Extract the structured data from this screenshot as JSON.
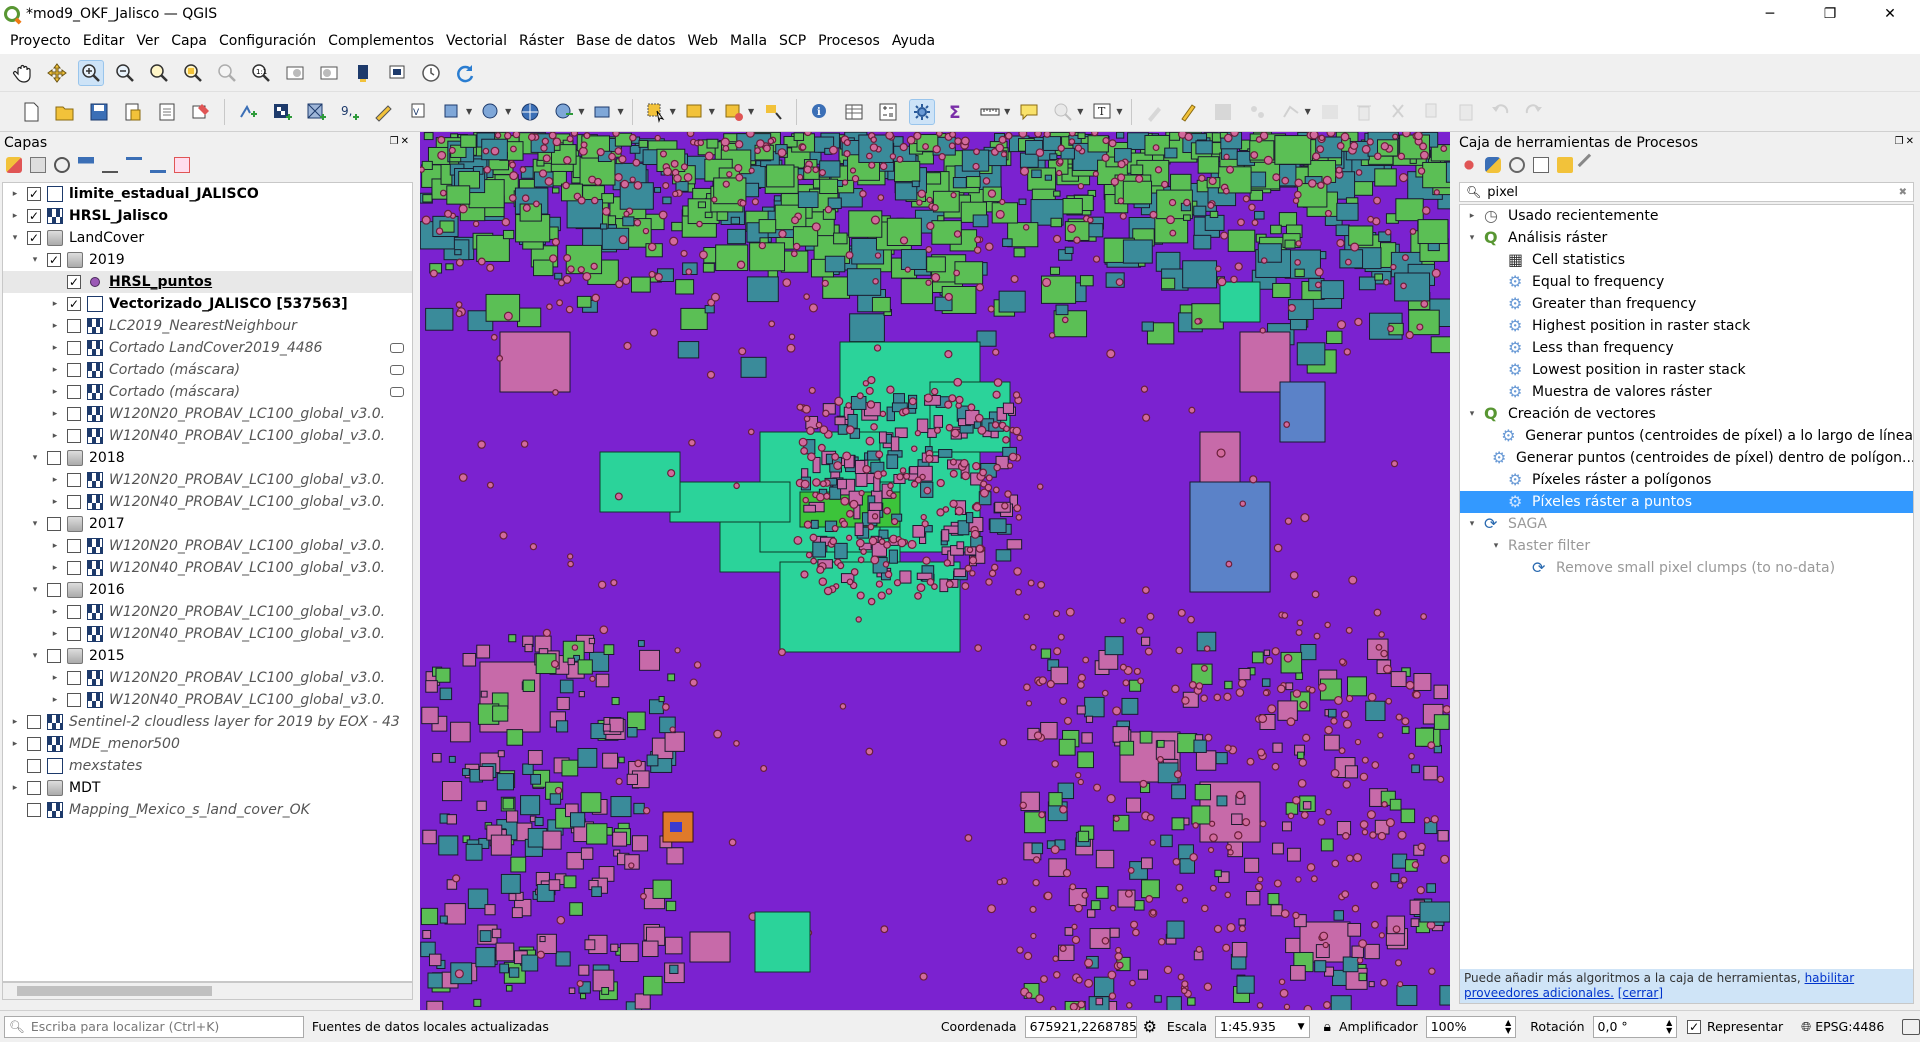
{
  "window": {
    "title": "*mod9_OKF_Jalisco — QGIS",
    "minimize": "─",
    "maximize": "❐",
    "close": "✕"
  },
  "menu": [
    "Proyecto",
    "Editar",
    "Ver",
    "Capa",
    "Configuración",
    "Complementos",
    "Vectorial",
    "Ráster",
    "Base de datos",
    "Web",
    "Malla",
    "SCP",
    "Procesos",
    "Ayuda"
  ],
  "layers_panel": {
    "title": "Capas",
    "layers": [
      {
        "name": "limite_estadual_JALISCO",
        "style": "b",
        "icon": "poly",
        "checked": true,
        "indent": 0,
        "arrow": "▸"
      },
      {
        "name": "HRSL_Jalisco",
        "style": "b",
        "icon": "raster",
        "checked": true,
        "indent": 0,
        "arrow": "▸"
      },
      {
        "name": "LandCover",
        "style": "",
        "icon": "grp",
        "checked": true,
        "indent": 0,
        "arrow": "▾"
      },
      {
        "name": "2019",
        "style": "",
        "icon": "grp",
        "checked": true,
        "indent": 1,
        "arrow": "▾"
      },
      {
        "name": "HRSL_puntos",
        "style": "b u",
        "icon": "pt",
        "checked": true,
        "indent": 2,
        "arrow": "",
        "selected": true
      },
      {
        "name": "Vectorizado_JALISCO [537563]",
        "style": "b",
        "icon": "poly",
        "checked": true,
        "indent": 2,
        "arrow": "▸"
      },
      {
        "name": "LC2019_NearestNeighbour",
        "style": "it",
        "icon": "raster",
        "checked": false,
        "indent": 2,
        "arrow": "▸"
      },
      {
        "name": "Cortado LandCover2019_4486",
        "style": "it",
        "icon": "raster",
        "checked": false,
        "indent": 2,
        "arrow": "▸",
        "temp": true
      },
      {
        "name": "Cortado (máscara)",
        "style": "it",
        "icon": "raster",
        "checked": false,
        "indent": 2,
        "arrow": "▸",
        "temp": true
      },
      {
        "name": "Cortado (máscara)",
        "style": "it",
        "icon": "raster",
        "checked": false,
        "indent": 2,
        "arrow": "▸",
        "temp": true
      },
      {
        "name": "W120N20_PROBAV_LC100_global_v3.0.",
        "style": "it",
        "icon": "raster",
        "checked": false,
        "indent": 2,
        "arrow": "▸"
      },
      {
        "name": "W120N40_PROBAV_LC100_global_v3.0.",
        "style": "it",
        "icon": "raster",
        "checked": false,
        "indent": 2,
        "arrow": "▸"
      },
      {
        "name": "2018",
        "style": "",
        "icon": "grp",
        "checked": false,
        "indent": 1,
        "arrow": "▾"
      },
      {
        "name": "W120N20_PROBAV_LC100_global_v3.0.",
        "style": "it",
        "icon": "raster",
        "checked": false,
        "indent": 2,
        "arrow": "▸"
      },
      {
        "name": "W120N40_PROBAV_LC100_global_v3.0.",
        "style": "it",
        "icon": "raster",
        "checked": false,
        "indent": 2,
        "arrow": "▸"
      },
      {
        "name": "2017",
        "style": "",
        "icon": "grp",
        "checked": false,
        "indent": 1,
        "arrow": "▾"
      },
      {
        "name": "W120N20_PROBAV_LC100_global_v3.0.",
        "style": "it",
        "icon": "raster",
        "checked": false,
        "indent": 2,
        "arrow": "▸"
      },
      {
        "name": "W120N40_PROBAV_LC100_global_v3.0.",
        "style": "it",
        "icon": "raster",
        "checked": false,
        "indent": 2,
        "arrow": "▸"
      },
      {
        "name": "2016",
        "style": "",
        "icon": "grp",
        "checked": false,
        "indent": 1,
        "arrow": "▾"
      },
      {
        "name": "W120N20_PROBAV_LC100_global_v3.0.",
        "style": "it",
        "icon": "raster",
        "checked": false,
        "indent": 2,
        "arrow": "▸"
      },
      {
        "name": "W120N40_PROBAV_LC100_global_v3.0.",
        "style": "it",
        "icon": "raster",
        "checked": false,
        "indent": 2,
        "arrow": "▸"
      },
      {
        "name": "2015",
        "style": "",
        "icon": "grp",
        "checked": false,
        "indent": 1,
        "arrow": "▾"
      },
      {
        "name": "W120N20_PROBAV_LC100_global_v3.0.",
        "style": "it",
        "icon": "raster",
        "checked": false,
        "indent": 2,
        "arrow": "▸"
      },
      {
        "name": "W120N40_PROBAV_LC100_global_v3.0.",
        "style": "it",
        "icon": "raster",
        "checked": false,
        "indent": 2,
        "arrow": "▸"
      },
      {
        "name": "Sentinel-2 cloudless layer for 2019 by EOX - 43",
        "style": "it",
        "icon": "raster",
        "checked": false,
        "indent": 0,
        "arrow": "▸"
      },
      {
        "name": "MDE_menor500",
        "style": "it",
        "icon": "raster",
        "checked": false,
        "indent": 0,
        "arrow": "▸"
      },
      {
        "name": "mexstates",
        "style": "it",
        "icon": "poly",
        "checked": false,
        "indent": 0,
        "arrow": ""
      },
      {
        "name": "MDT",
        "style": "",
        "icon": "grp",
        "checked": false,
        "indent": 0,
        "arrow": "▸"
      },
      {
        "name": "Mapping_Mexico_s_land_cover_OK",
        "style": "it",
        "icon": "raster",
        "checked": false,
        "indent": 0,
        "arrow": ""
      }
    ]
  },
  "processing": {
    "title": "Caja de herramientas de Procesos",
    "search": "pixel",
    "tree": [
      {
        "label": "Usado recientemente",
        "icon": "clock",
        "arrow": "▸",
        "indent": 0
      },
      {
        "label": "Análisis ráster",
        "icon": "q",
        "arrow": "▾",
        "indent": 0
      },
      {
        "label": "Cell statistics",
        "icon": "stat",
        "arrow": "",
        "indent": 1
      },
      {
        "label": "Equal to frequency",
        "icon": "gear",
        "arrow": "",
        "indent": 1
      },
      {
        "label": "Greater than frequency",
        "icon": "gear",
        "arrow": "",
        "indent": 1
      },
      {
        "label": "Highest position in raster stack",
        "icon": "gear",
        "arrow": "",
        "indent": 1
      },
      {
        "label": "Less than frequency",
        "icon": "gear",
        "arrow": "",
        "indent": 1
      },
      {
        "label": "Lowest position in raster stack",
        "icon": "gear",
        "arrow": "",
        "indent": 1
      },
      {
        "label": "Muestra de valores ráster",
        "icon": "gear",
        "arrow": "",
        "indent": 1
      },
      {
        "label": "Creación de vectores",
        "icon": "q",
        "arrow": "▾",
        "indent": 0
      },
      {
        "label": "Generar puntos (centroides de píxel) a lo largo de línea",
        "icon": "gear",
        "arrow": "",
        "indent": 1
      },
      {
        "label": "Generar puntos (centroides de píxel) dentro de polígon...",
        "icon": "gear",
        "arrow": "",
        "indent": 1
      },
      {
        "label": "Píxeles ráster a polígonos",
        "icon": "gear",
        "arrow": "",
        "indent": 1
      },
      {
        "label": "Píxeles ráster a puntos",
        "icon": "gear",
        "arrow": "",
        "indent": 1,
        "selected": true
      },
      {
        "label": "SAGA",
        "icon": "saga",
        "arrow": "▾",
        "indent": 0,
        "grey": true
      },
      {
        "label": "Raster filter",
        "icon": "",
        "arrow": "▾",
        "indent": 1,
        "grey": true
      },
      {
        "label": "Remove small pixel clumps (to no-data)",
        "icon": "saga",
        "arrow": "",
        "indent": 2,
        "grey": true
      }
    ],
    "notice_text": "Puede añadir más algoritmos a la caja de herramientas, ",
    "notice_link": "habilitar proveedores adicionales.",
    "notice_close": "[cerrar]"
  },
  "status": {
    "locator_placeholder": "Escriba para localizar (Ctrl+K)",
    "message": "Fuentes de datos locales actualizadas",
    "coord_label": "Coordenada",
    "coord_value": "675921,2268785",
    "scale_label": "Escala",
    "scale_value": "1:45.935",
    "magnifier_label": "Amplificador",
    "magnifier_value": "100%",
    "rotation_label": "Rotación",
    "rotation_value": "0,0 °",
    "render_label": "Representar",
    "crs": "EPSG:4486"
  },
  "colors": {
    "map_bg": "#7b22d0",
    "forest": "#5bbf55",
    "water_green": "#2bd39a",
    "pink": "#c76aa9",
    "teal": "#3a8b9a",
    "blue": "#5b82c8",
    "selection": "#3399ff"
  }
}
